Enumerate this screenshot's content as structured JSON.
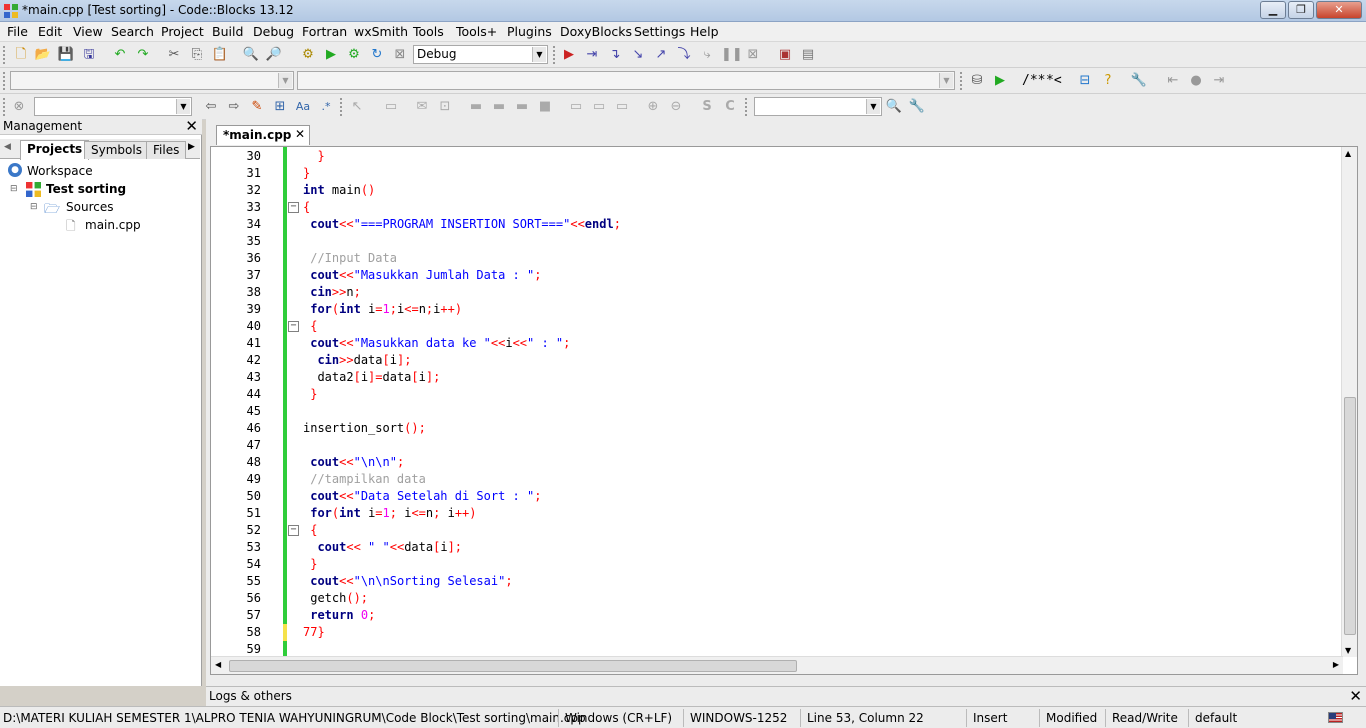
{
  "window": {
    "title": "*main.cpp [Test sorting] - Code::Blocks 13.12"
  },
  "menu": [
    "File",
    "Edit",
    "View",
    "Search",
    "Project",
    "Build",
    "Debug",
    "Fortran",
    "wxSmith",
    "Tools",
    "Tools+",
    "Plugins",
    "DoxyBlocks",
    "Settings",
    "Help"
  ],
  "toolbar": {
    "build_target": "Debug",
    "doxy_comment_labels": [
      "/**",
      "*<"
    ],
    "s_label": "S",
    "c_label": "C"
  },
  "management": {
    "title": "Management",
    "tabs": [
      "Projects",
      "Symbols",
      "Files"
    ],
    "tree": {
      "workspace": "Workspace",
      "project": "Test sorting",
      "folder": "Sources",
      "file": "main.cpp"
    }
  },
  "editor": {
    "tab_label": "*main.cpp",
    "lines": [
      {
        "n": "30",
        "html": "  <span class='op'>}</span>"
      },
      {
        "n": "31",
        "html": "<span class='op'>}</span>"
      },
      {
        "n": "32",
        "html": "<span class='kw'>int</span> main<span class='op'>()</span>"
      },
      {
        "n": "33",
        "html": "<span class='op'>{</span>"
      },
      {
        "n": "34",
        "html": " <span class='kw'>cout</span><span class='op'>&lt;&lt;</span><span class='str'>\"===PROGRAM INSERTION SORT===\"</span><span class='op'>&lt;&lt;</span><span class='kw'>endl</span><span class='op'>;</span>"
      },
      {
        "n": "35",
        "html": ""
      },
      {
        "n": "36",
        "html": " <span class='cmt'>//Input Data</span>"
      },
      {
        "n": "37",
        "html": " <span class='kw'>cout</span><span class='op'>&lt;&lt;</span><span class='str'>\"Masukkan Jumlah Data : \"</span><span class='op'>;</span>"
      },
      {
        "n": "38",
        "html": " <span class='kw'>cin</span><span class='op'>&gt;&gt;</span>n<span class='op'>;</span>"
      },
      {
        "n": "39",
        "html": " <span class='kw'>for</span><span class='op'>(</span><span class='kw'>int</span> i<span class='op'>=</span><span class='num'>1</span><span class='op'>;</span>i<span class='op'>&lt;=</span>n<span class='op'>;</span>i<span class='op'>++)</span>"
      },
      {
        "n": "40",
        "html": " <span class='op'>{</span>"
      },
      {
        "n": "41",
        "html": " <span class='kw'>cout</span><span class='op'>&lt;&lt;</span><span class='str'>\"Masukkan data ke \"</span><span class='op'>&lt;&lt;</span>i<span class='op'>&lt;&lt;</span><span class='str'>\" : \"</span><span class='op'>;</span>"
      },
      {
        "n": "42",
        "html": "  <span class='kw'>cin</span><span class='op'>&gt;&gt;</span>data<span class='op'>[</span>i<span class='op'>];</span>"
      },
      {
        "n": "43",
        "html": "  data2<span class='op'>[</span>i<span class='op'>]=</span>data<span class='op'>[</span>i<span class='op'>];</span>"
      },
      {
        "n": "44",
        "html": " <span class='op'>}</span>"
      },
      {
        "n": "45",
        "html": ""
      },
      {
        "n": "46",
        "html": "insertion_sort<span class='op'>();</span>"
      },
      {
        "n": "47",
        "html": ""
      },
      {
        "n": "48",
        "html": " <span class='kw'>cout</span><span class='op'>&lt;&lt;</span><span class='str'>\"\\n\\n\"</span><span class='op'>;</span>"
      },
      {
        "n": "49",
        "html": " <span class='cmt'>//tampilkan data</span>"
      },
      {
        "n": "50",
        "html": " <span class='kw'>cout</span><span class='op'>&lt;&lt;</span><span class='str'>\"Data Setelah di Sort : \"</span><span class='op'>;</span>"
      },
      {
        "n": "51",
        "html": " <span class='kw'>for</span><span class='op'>(</span><span class='kw'>int</span> i<span class='op'>=</span><span class='num'>1</span><span class='op'>;</span> i<span class='op'>&lt;=</span>n<span class='op'>;</span> i<span class='op'>++)</span>"
      },
      {
        "n": "52",
        "html": " <span class='op'>{</span>"
      },
      {
        "n": "53",
        "html": "  <span class='kw'>cout</span><span class='op'>&lt;&lt;</span> <span class='str'>\" \"</span><span class='op'>&lt;&lt;</span>data<span class='op'>[</span>i<span class='op'>];</span>"
      },
      {
        "n": "54",
        "html": " <span class='op'>}</span>"
      },
      {
        "n": "55",
        "html": " <span class='kw'>cout</span><span class='op'>&lt;&lt;</span><span class='str'>\"\\n\\nSorting Selesai\"</span><span class='op'>;</span>"
      },
      {
        "n": "56",
        "html": " getch<span class='op'>();</span>"
      },
      {
        "n": "57",
        "html": " <span class='kw'>return</span> <span class='num'>0</span><span class='op'>;</span>"
      },
      {
        "n": "58",
        "html": "<span class='op'>77}</span>"
      },
      {
        "n": "59",
        "html": ""
      }
    ]
  },
  "logs": {
    "title": "Logs & others"
  },
  "status": {
    "path": "D:\\MATERI KULIAH SEMESTER 1\\ALPRO TENIA WAHYUNINGRUM\\Code Block\\Test sorting\\main.cpp",
    "eol": "Windows (CR+LF)",
    "encoding": "WINDOWS-1252",
    "position": "Line 53, Column 22",
    "mode": "Insert",
    "modified": "Modified",
    "access": "Read/Write",
    "profile": "default"
  }
}
